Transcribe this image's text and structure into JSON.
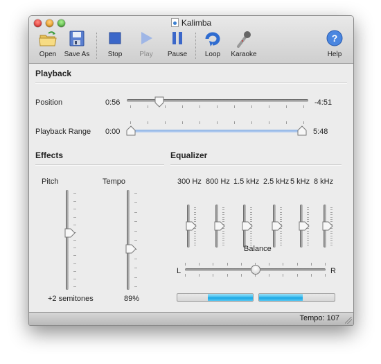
{
  "window": {
    "title": "Kalimba",
    "traffic_lights": [
      "close",
      "minimize",
      "zoom"
    ]
  },
  "toolbar": {
    "items": [
      {
        "id": "open",
        "label": "Open",
        "icon": "folder-open-icon",
        "enabled": true
      },
      {
        "id": "save-as",
        "label": "Save As",
        "icon": "floppy-disk-icon",
        "enabled": true
      },
      {
        "id": "stop",
        "label": "Stop",
        "icon": "stop-icon",
        "enabled": true
      },
      {
        "id": "play",
        "label": "Play",
        "icon": "play-icon",
        "enabled": false
      },
      {
        "id": "pause",
        "label": "Pause",
        "icon": "pause-icon",
        "enabled": true
      },
      {
        "id": "loop",
        "label": "Loop",
        "icon": "loop-icon",
        "enabled": true
      },
      {
        "id": "karaoke",
        "label": "Karaoke",
        "icon": "microphone-icon",
        "enabled": true
      },
      {
        "id": "help",
        "label": "Help",
        "icon": "help-icon",
        "enabled": true
      }
    ]
  },
  "playback": {
    "title": "Playback",
    "position": {
      "label": "Position",
      "elapsed": "0:56",
      "remaining": "-4:51",
      "fraction": 0.16
    },
    "range": {
      "label": "Playback Range",
      "start": "0:00",
      "end": "5:48",
      "start_fraction": 0.0,
      "end_fraction": 1.0
    }
  },
  "effects": {
    "title": "Effects",
    "pitch": {
      "label": "Pitch",
      "value_text": "+2 semitones",
      "fraction": 0.58
    },
    "tempo": {
      "label": "Tempo",
      "value_text": "89%",
      "fraction": 0.4
    }
  },
  "equalizer": {
    "title": "Equalizer",
    "bands": [
      {
        "label": "300 Hz",
        "fraction": 0.5
      },
      {
        "label": "800 Hz",
        "fraction": 0.5
      },
      {
        "label": "1.5 kHz",
        "fraction": 0.5
      },
      {
        "label": "2.5 kHz",
        "fraction": 0.5
      },
      {
        "label": "5 kHz",
        "fraction": 0.5
      },
      {
        "label": "8 kHz",
        "fraction": 0.5
      }
    ],
    "balance": {
      "label": "Balance",
      "left_label": "L",
      "right_label": "R",
      "fraction": 0.5
    },
    "meters": {
      "left_level": 0.6,
      "right_level": 0.58
    }
  },
  "status": {
    "text": "Tempo: 107"
  }
}
